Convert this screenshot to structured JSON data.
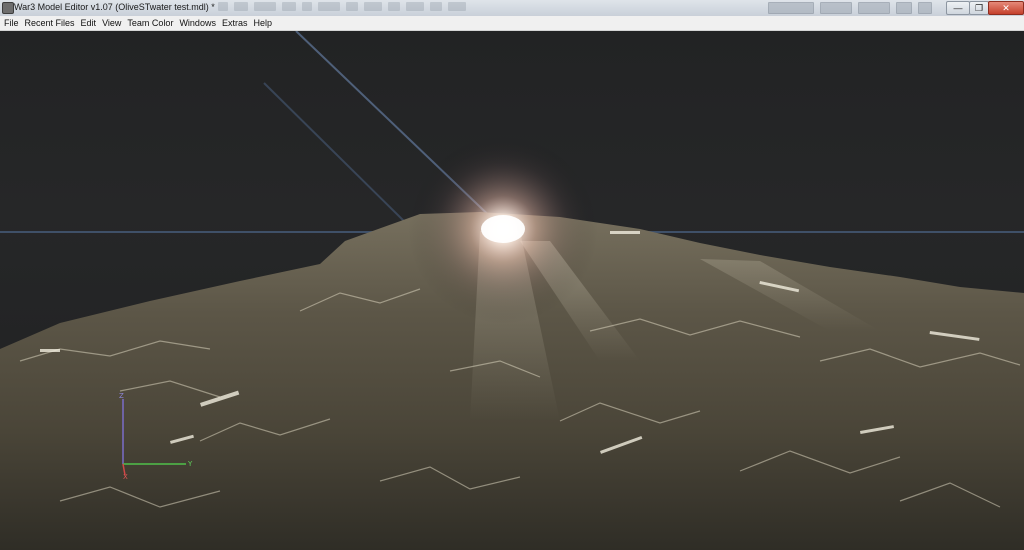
{
  "window": {
    "title": "War3 Model Editor v1.07 (OliveSTwater test.mdl) *",
    "controls": {
      "minimize": "—",
      "maximize": "❐",
      "close": "✕"
    }
  },
  "menu": [
    "File",
    "Recent Files",
    "Edit",
    "View",
    "Team Color",
    "Windows",
    "Extras",
    "Help"
  ],
  "viewport": {
    "axes": {
      "z": "Z",
      "y": "Y",
      "x": "X"
    },
    "colors": {
      "background": "#232425",
      "axis_z": "#7a6cc8",
      "axis_y": "#4fc04a",
      "axis_x": "#d04848",
      "grid_line": "#3d4d66",
      "light_glow": "#ffe8dc",
      "water_dark": "#3b3a31",
      "water_mid": "#6e6a58",
      "water_light": "#c9c4ae"
    }
  }
}
